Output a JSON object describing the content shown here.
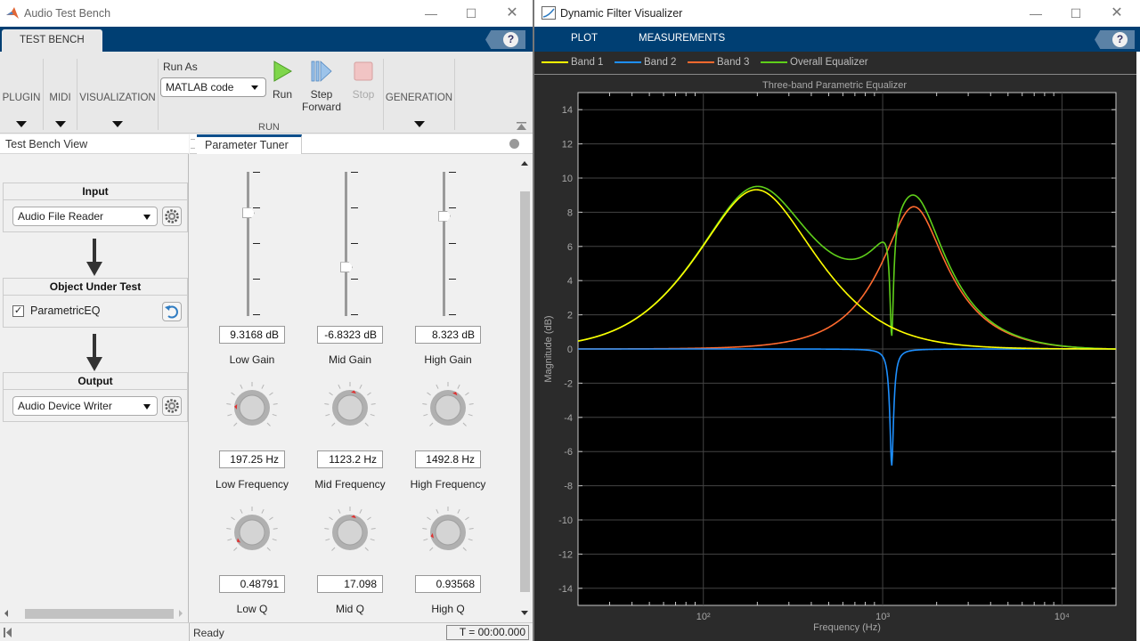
{
  "left_window": {
    "title": "Audio Test Bench",
    "ribbon_tab": "TEST BENCH",
    "help": "?",
    "toolstrip": {
      "plugin": "PLUGIN",
      "midi": "MIDI",
      "visualization": "VISUALIZATION",
      "run_as_label": "Run As",
      "run_as_value": "MATLAB code",
      "run": "Run",
      "step_forward_line1": "Step",
      "step_forward_line2": "Forward",
      "stop": "Stop",
      "run_group": "RUN",
      "generation": "GENERATION"
    },
    "test_bench_view": {
      "header": "Test Bench View",
      "input_title": "Input",
      "input_value": "Audio File Reader",
      "object_title": "Object Under Test",
      "object_name": "ParametricEQ",
      "object_checked": true,
      "output_title": "Output",
      "output_value": "Audio Device Writer"
    },
    "parameter_tuner": {
      "tab": "Parameter Tuner",
      "gains": [
        {
          "label": "Low Gain",
          "value": "9.3168 dB",
          "fraction": 0.71
        },
        {
          "label": "Mid Gain",
          "value": "-6.8323 dB",
          "fraction": 0.33
        },
        {
          "label": "High Gain",
          "value": "8.323 dB",
          "fraction": 0.69
        }
      ],
      "frequencies": [
        {
          "label": "Low Frequency",
          "value": "197.25 Hz",
          "fraction": 0.18
        },
        {
          "label": "Mid Frequency",
          "value": "1123.2 Hz",
          "fraction": 0.55
        },
        {
          "label": "High Frequency",
          "value": "1492.8 Hz",
          "fraction": 0.6
        }
      ],
      "qs": [
        {
          "label": "Low Q",
          "value": "0.48791",
          "fraction": 0.05
        },
        {
          "label": "Mid Q",
          "value": "17.098",
          "fraction": 0.55
        },
        {
          "label": "High Q",
          "value": "0.93568",
          "fraction": 0.12
        }
      ]
    },
    "status": {
      "text": "Ready",
      "time": "T = 00:00.000"
    }
  },
  "right_window": {
    "title": "Dynamic Filter Visualizer",
    "tabs": [
      "PLOT",
      "MEASUREMENTS"
    ],
    "help": "?"
  },
  "chart_data": {
    "type": "line",
    "title": "Three-band Parametric Equalizer",
    "xlabel": "Frequency (Hz)",
    "ylabel": "Magnitude (dB)",
    "xscale": "log",
    "xlim": [
      20,
      20000
    ],
    "ylim": [
      -15,
      15
    ],
    "xticks": [
      100,
      1000,
      10000
    ],
    "xtick_labels": [
      "10²",
      "10³",
      "10⁴"
    ],
    "yticks": [
      -14,
      -12,
      -10,
      -8,
      -6,
      -4,
      -2,
      0,
      2,
      4,
      6,
      8,
      10,
      12,
      14
    ],
    "grid": true,
    "legend_position": "top",
    "background": "#000000",
    "series": [
      {
        "name": "Band 1",
        "color": "#ffff00",
        "f0": 197.25,
        "gain_db": 9.3168,
        "q": 0.48791
      },
      {
        "name": "Band 2",
        "color": "#1e90ff",
        "f0": 1123.2,
        "gain_db": -6.8323,
        "q": 17.098
      },
      {
        "name": "Band 3",
        "color": "#ff6a2e",
        "f0": 1492.8,
        "gain_db": 8.323,
        "q": 0.93568
      },
      {
        "name": "Overall Equalizer",
        "color": "#5fcf1a",
        "composition": "sum of bands"
      }
    ]
  }
}
